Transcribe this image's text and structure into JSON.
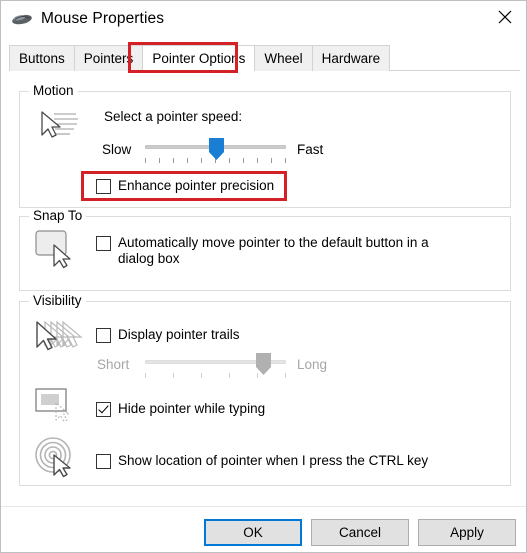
{
  "window": {
    "title": "Mouse Properties",
    "icon": "mouse-icon",
    "close_label": "✕"
  },
  "tabs": [
    {
      "label": "Buttons",
      "active": false
    },
    {
      "label": "Pointers",
      "active": false
    },
    {
      "label": "Pointer Options",
      "active": true
    },
    {
      "label": "Wheel",
      "active": false
    },
    {
      "label": "Hardware",
      "active": false
    }
  ],
  "annotations": {
    "color": "#d42027",
    "highlight_tab": "Pointer Options",
    "highlight_checkbox": "Enhance pointer precision"
  },
  "motion": {
    "group_label": "Motion",
    "icon": "pointer-speed-icon",
    "prompt": "Select a pointer speed:",
    "slider": {
      "min_label": "Slow",
      "max_label": "Fast",
      "value": 5,
      "min": 0,
      "max": 10,
      "ticks": 11,
      "thumb_color": "#1a7fd4",
      "enabled": true
    },
    "enhance_precision": {
      "label": "Enhance pointer precision",
      "checked": false
    }
  },
  "snap_to": {
    "group_label": "Snap To",
    "icon": "default-button-icon",
    "auto_move": {
      "label": "Automatically move pointer to the default button in a dialog box",
      "checked": false
    }
  },
  "visibility": {
    "group_label": "Visibility",
    "pointer_trails": {
      "icon": "pointer-trails-icon",
      "label": "Display pointer trails",
      "checked": false,
      "slider": {
        "min_label": "Short",
        "max_label": "Long",
        "value": 5,
        "min": 0,
        "max": 6,
        "ticks": 6,
        "thumb_color": "#b0b0b0",
        "enabled": false
      }
    },
    "hide_while_typing": {
      "icon": "hide-pointer-icon",
      "label": "Hide pointer while typing",
      "checked": true
    },
    "show_location_ctrl": {
      "icon": "locate-pointer-icon",
      "label": "Show location of pointer when I press the CTRL key",
      "checked": false
    }
  },
  "footer": {
    "ok": "OK",
    "cancel": "Cancel",
    "apply": "Apply"
  }
}
